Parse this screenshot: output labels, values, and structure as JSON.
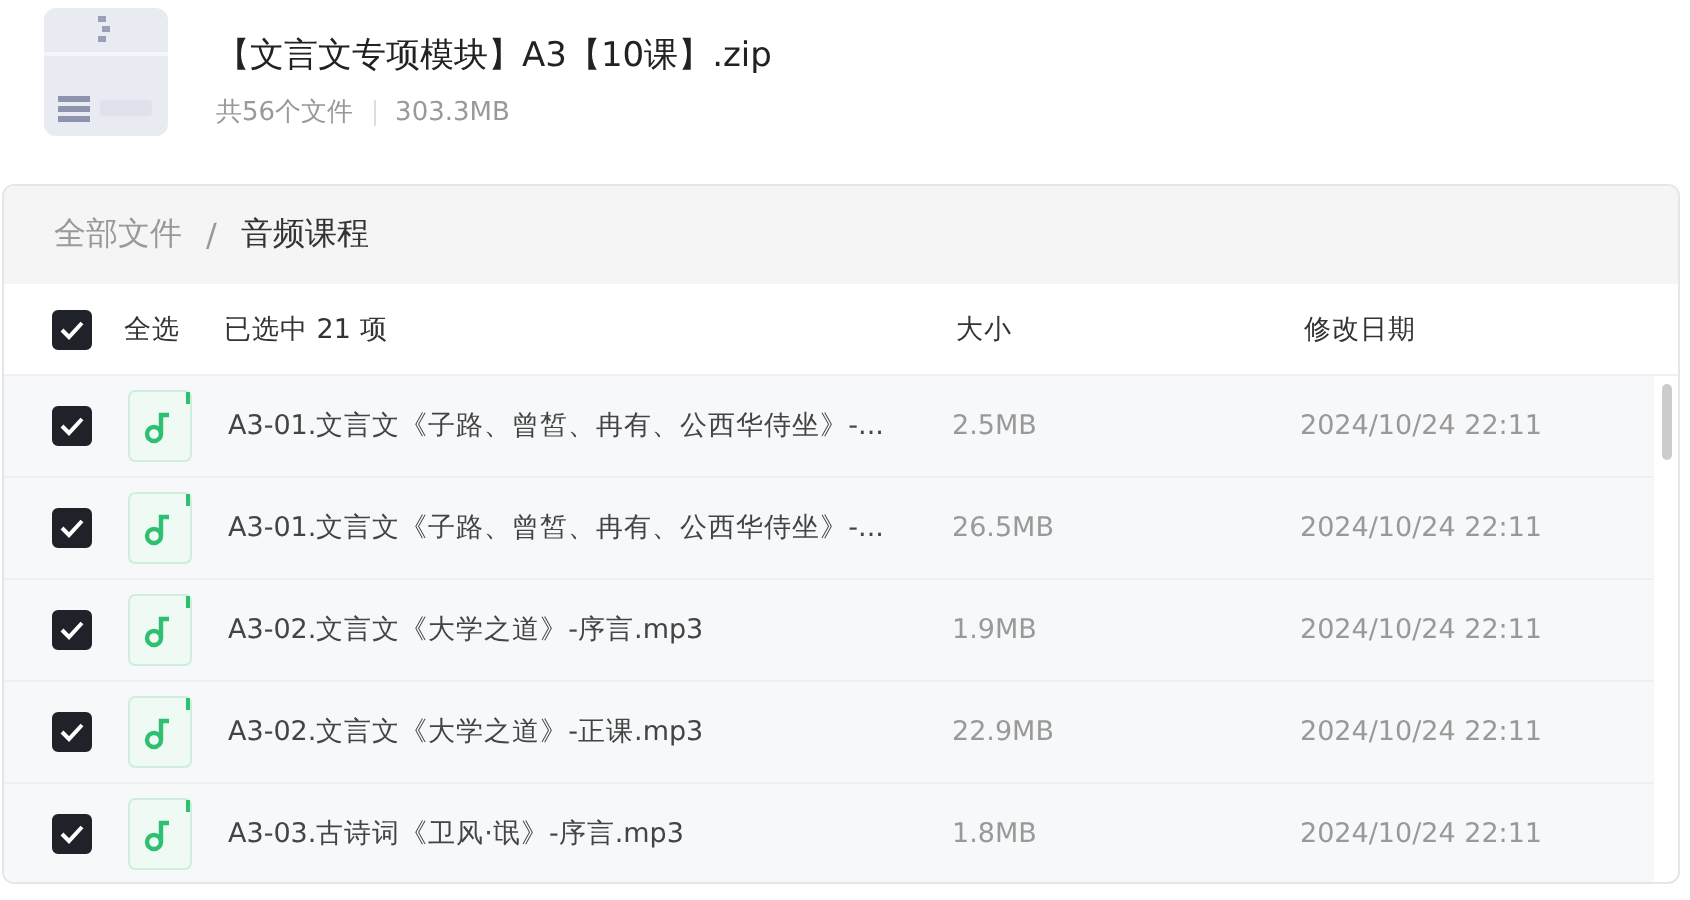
{
  "archive": {
    "title": "【文言文专项模块】A3【10课】.zip",
    "file_count": "共56个文件",
    "size": "303.3MB"
  },
  "breadcrumb_separator": "/",
  "breadcrumb": [
    {
      "label": "全部文件",
      "selected": false
    },
    {
      "label": "音频课程",
      "selected": true
    }
  ],
  "header": {
    "select_all": {
      "label": "全选",
      "checked": true
    },
    "selection": "已选中 21 项",
    "columns": [
      "大小",
      "修改日期"
    ]
  },
  "rows": [
    {
      "name": "A3-01.文言文《子路、曾皙、冉有、公西华侍坐》-...",
      "size": "2.5MB",
      "date": "2024/10/24 22:11",
      "checked": true
    },
    {
      "name": "A3-01.文言文《子路、曾皙、冉有、公西华侍坐》-...",
      "size": "26.5MB",
      "date": "2024/10/24 22:11",
      "checked": true
    },
    {
      "name": "A3-02.文言文《大学之道》-序言.mp3",
      "size": "1.9MB",
      "date": "2024/10/24 22:11",
      "checked": true
    },
    {
      "name": "A3-02.文言文《大学之道》-正课.mp3",
      "size": "22.9MB",
      "date": "2024/10/24 22:11",
      "checked": true
    },
    {
      "name": "A3-03.古诗词《卫风·氓》-序言.mp3",
      "size": "1.8MB",
      "date": "2024/10/24 22:11",
      "checked": true
    }
  ]
}
